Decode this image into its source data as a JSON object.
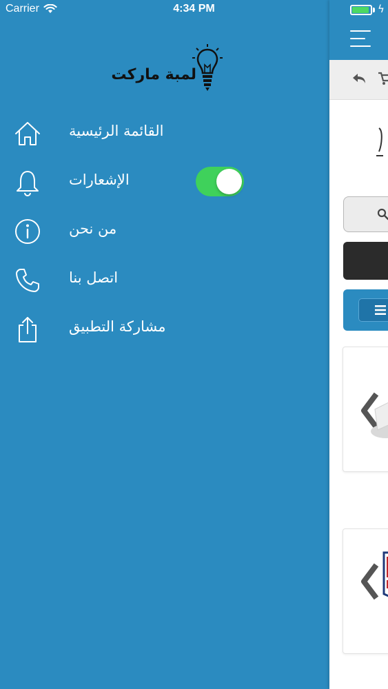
{
  "status_bar": {
    "carrier": "Carrier",
    "time": "4:34 PM"
  },
  "drawer": {
    "logo_text": "لمبة ماركت",
    "items": [
      {
        "label": "القائمة الرئيسية",
        "icon": "home-icon"
      },
      {
        "label": "الإشعارات",
        "icon": "bell-icon",
        "toggle_on": true
      },
      {
        "label": "من نحن",
        "icon": "info-icon"
      },
      {
        "label": "اتصل بنا",
        "icon": "phone-icon"
      },
      {
        "label": "مشاركة التطبيق",
        "icon": "share-icon"
      }
    ]
  },
  "colors": {
    "primary": "#2b8bc0",
    "toggle_on": "#3fd15b",
    "battery": "#4cd964",
    "dark_button": "#2b2b2b"
  }
}
